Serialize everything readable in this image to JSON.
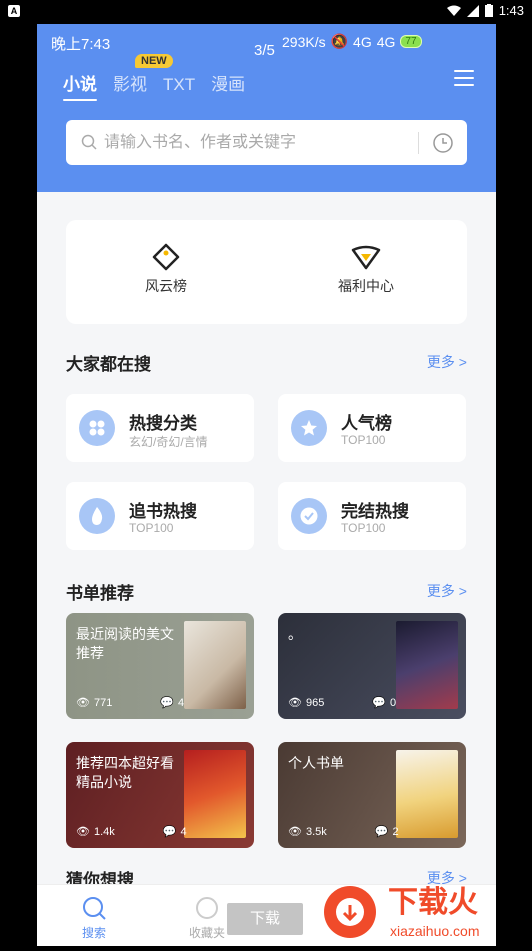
{
  "system_status": {
    "time": "1:43"
  },
  "app_status": {
    "time": "晚上7:43",
    "page_indicator": "3/5",
    "speed": "293K/s",
    "net1": "4G",
    "net2": "4G",
    "battery": "77"
  },
  "tabs": [
    {
      "label": "小说",
      "active": true
    },
    {
      "label": "影视",
      "active": false
    },
    {
      "label": "TXT",
      "active": false
    },
    {
      "label": "漫画",
      "active": false
    }
  ],
  "new_badge": "NEW",
  "search": {
    "placeholder": "请输入书名、作者或关键字"
  },
  "quick_links": [
    {
      "label": "风云榜",
      "icon": "tag-icon"
    },
    {
      "label": "福利中心",
      "icon": "gift-icon"
    }
  ],
  "popular": {
    "title": "大家都在搜",
    "more": "更多 >",
    "items": [
      {
        "title": "热搜分类",
        "sub": "玄幻/奇幻/言情",
        "icon": "grid-icon"
      },
      {
        "title": "人气榜",
        "sub": "TOP100",
        "icon": "star-icon"
      },
      {
        "title": "追书热搜",
        "sub": "TOP100",
        "icon": "flame-icon"
      },
      {
        "title": "完结热搜",
        "sub": "TOP100",
        "icon": "check-icon"
      }
    ]
  },
  "booklists": {
    "title": "书单推荐",
    "more": "更多 >",
    "items": [
      {
        "title": "最近阅读的美文推荐",
        "views": "771",
        "comments": "4",
        "bg": "#8f9487"
      },
      {
        "title": "。",
        "views": "965",
        "comments": "0",
        "bg": "#3a3c48"
      },
      {
        "title": "推荐四本超好看精品小说",
        "views": "1.4k",
        "comments": "4",
        "bg": "#7a2a2a"
      },
      {
        "title": "个人书单",
        "views": "3.5k",
        "comments": "2",
        "bg": "#5a4a3f"
      }
    ]
  },
  "guess": {
    "title": "猜你想搜",
    "more": "更多 >"
  },
  "bottom_nav": [
    {
      "label": "搜索",
      "active": true
    },
    {
      "label": "收藏夹",
      "active": false
    }
  ],
  "download_label": "下载",
  "watermark": {
    "title": "下载火",
    "url": "xiazaihuo.com"
  },
  "colors": {
    "accent": "#5b8ff0",
    "header": "#5b8ff0"
  }
}
